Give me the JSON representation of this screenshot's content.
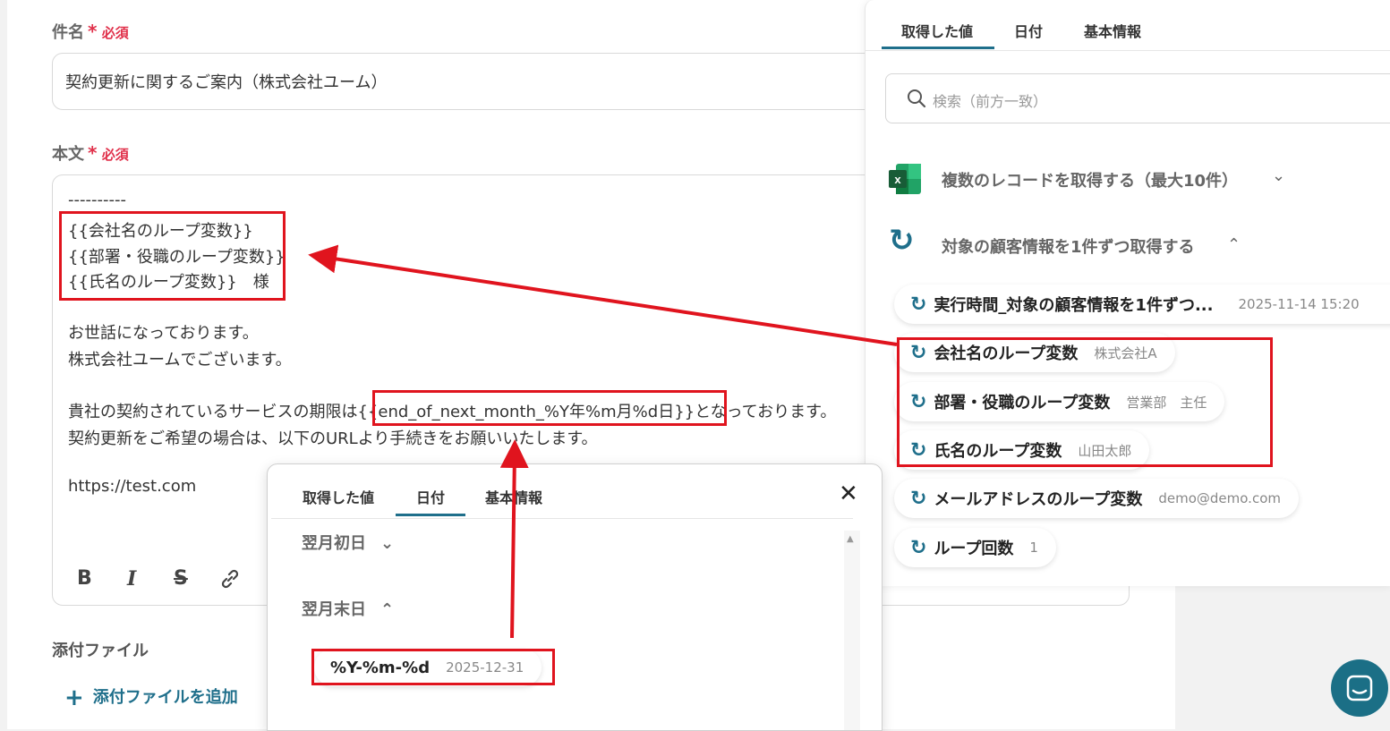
{
  "subject": {
    "label": "件名",
    "required": "必須",
    "value": "契約更新に関するご案内（株式会社ユーム）"
  },
  "body": {
    "label": "本文",
    "required": "必須",
    "lines": [
      "----------",
      "{{会社名のループ変数}}",
      "{{部署・役職のループ変数}}",
      "{{氏名のループ変数}}　様",
      "お世話になっております。",
      "株式会社ユームでございます。",
      "貴社の契約されているサービスの期限は",
      "{{end_of_next_month_%Y年%m月%d日}}",
      "となっております。",
      "契約更新をご希望の場合は、以下のURLより手続きをお願いいたします。",
      "https://test.com"
    ]
  },
  "toolbar": {
    "bold": "B",
    "italic": "I",
    "strike": "S",
    "link": "🔗"
  },
  "attachment": {
    "label": "添付ファイル",
    "add_label": "添付ファイルを追加",
    "add_icon": "+"
  },
  "right_panel": {
    "tabs": [
      "取得した値",
      "日付",
      "基本情報"
    ],
    "search_placeholder": "検索（前方一致）",
    "group1": {
      "label": "複数のレコードを取得する（最大10件）",
      "icon": "excel-icon"
    },
    "group2": {
      "label": "対象の顧客情報を1件ずつ取得する",
      "icon": "loop-icon"
    },
    "items": [
      {
        "name": "実行時間_対象の顧客情報を1件ずつ...",
        "value": "2025-11-14 15:20"
      },
      {
        "name": "会社名のループ変数",
        "value": "株式会社A"
      },
      {
        "name": "部署・役職のループ変数",
        "value": "営業部　主任"
      },
      {
        "name": "氏名のループ変数",
        "value": "山田太郎"
      },
      {
        "name": "メールアドレスのループ変数",
        "value": "demo@demo.com"
      },
      {
        "name": "ループ回数",
        "value": "1"
      }
    ]
  },
  "popup": {
    "tabs": [
      "取得した値",
      "日付",
      "基本情報"
    ],
    "close": "✕",
    "sections": [
      "翌月初日",
      "翌月末日"
    ],
    "item": {
      "name": "%Y-%m-%d",
      "value": "2025-12-31"
    }
  },
  "colors": {
    "accent": "#1f6f8b",
    "highlight": "#e0141e",
    "required": "#e0304a"
  }
}
